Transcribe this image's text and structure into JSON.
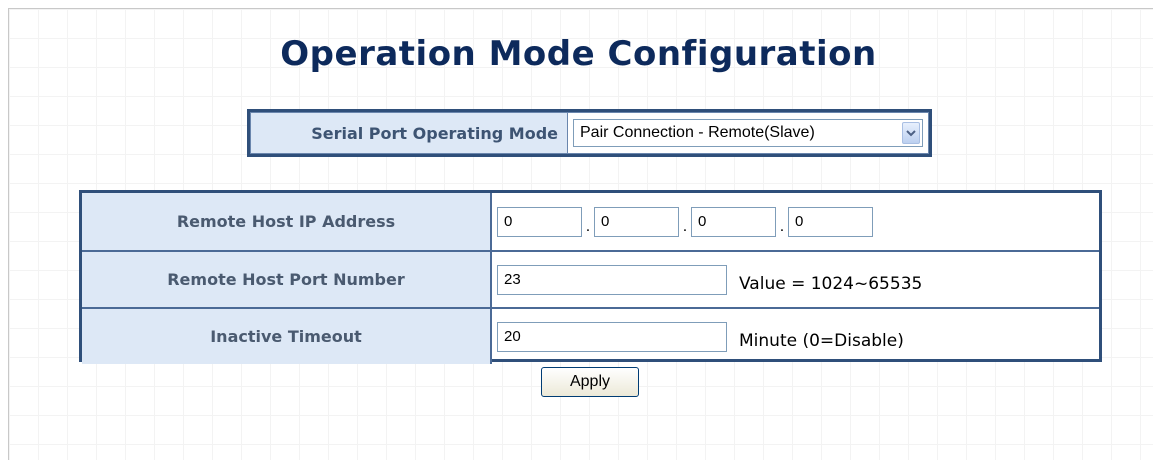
{
  "page": {
    "title": "Operation Mode Configuration"
  },
  "mode": {
    "label": "Serial Port Operating Mode",
    "selected": "Pair Connection - Remote(Slave)"
  },
  "rows": [
    {
      "label": "Remote Host IP Address",
      "ip": [
        "0",
        "0",
        "0",
        "0"
      ],
      "separator": "."
    },
    {
      "label": "Remote Host Port Number",
      "value": "23",
      "hint": "Value = 1024~65535"
    },
    {
      "label": "Inactive Timeout",
      "value": "20",
      "hint": "Minute (0=Disable)"
    }
  ],
  "actions": {
    "apply_label": "Apply"
  },
  "colors": {
    "title": "#0d2a5c",
    "table_border": "#2f4f7a",
    "label_bg": "#dde8f6",
    "label_text": "#4a5a70"
  },
  "icons": {
    "dropdown": "chevron-down-icon"
  }
}
